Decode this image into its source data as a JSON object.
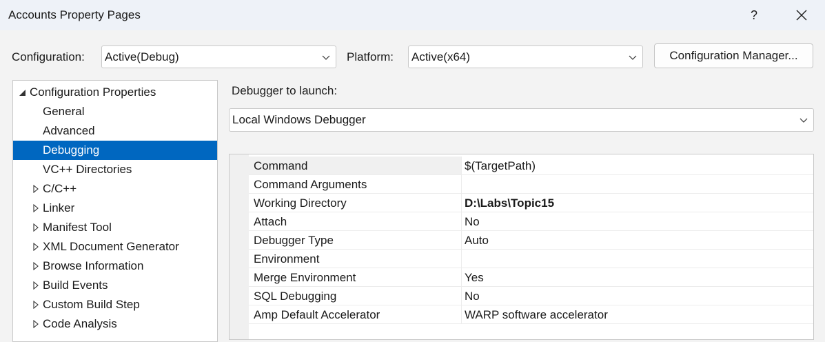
{
  "window": {
    "title": "Accounts Property Pages",
    "help_label": "?",
    "close_icon": "close-icon"
  },
  "toolbar": {
    "configuration_label": "Configuration:",
    "configuration_value": "Active(Debug)",
    "platform_label": "Platform:",
    "platform_value": "Active(x64)",
    "config_manager_label": "Configuration Manager..."
  },
  "tree": {
    "items": [
      {
        "label": "Configuration Properties",
        "expanded": true,
        "level": 0
      },
      {
        "label": "General",
        "level": 1
      },
      {
        "label": "Advanced",
        "level": 1
      },
      {
        "label": "Debugging",
        "level": 1,
        "selected": true
      },
      {
        "label": "VC++ Directories",
        "level": 1
      },
      {
        "label": "C/C++",
        "level": 1,
        "collapsed": true
      },
      {
        "label": "Linker",
        "level": 1,
        "collapsed": true
      },
      {
        "label": "Manifest Tool",
        "level": 1,
        "collapsed": true
      },
      {
        "label": "XML Document Generator",
        "level": 1,
        "collapsed": true
      },
      {
        "label": "Browse Information",
        "level": 1,
        "collapsed": true
      },
      {
        "label": "Build Events",
        "level": 1,
        "collapsed": true
      },
      {
        "label": "Custom Build Step",
        "level": 1,
        "collapsed": true
      },
      {
        "label": "Code Analysis",
        "level": 1,
        "collapsed": true
      }
    ]
  },
  "debugger": {
    "launch_label": "Debugger to launch:",
    "launch_value": "Local Windows Debugger"
  },
  "properties": [
    {
      "name": "Command",
      "value": "$(TargetPath)",
      "bold": false,
      "selected": true
    },
    {
      "name": "Command Arguments",
      "value": "",
      "bold": false
    },
    {
      "name": "Working Directory",
      "value": "D:\\Labs\\Topic15",
      "bold": true
    },
    {
      "name": "Attach",
      "value": "No",
      "bold": false
    },
    {
      "name": "Debugger Type",
      "value": "Auto",
      "bold": false
    },
    {
      "name": "Environment",
      "value": "",
      "bold": false
    },
    {
      "name": "Merge Environment",
      "value": "Yes",
      "bold": false
    },
    {
      "name": "SQL Debugging",
      "value": "No",
      "bold": false
    },
    {
      "name": "Amp Default Accelerator",
      "value": "WARP software accelerator",
      "bold": false
    }
  ],
  "colors": {
    "selection": "#0067c0",
    "titlebar": "#eef2f8",
    "dialog_bg": "#f3f3f3"
  }
}
